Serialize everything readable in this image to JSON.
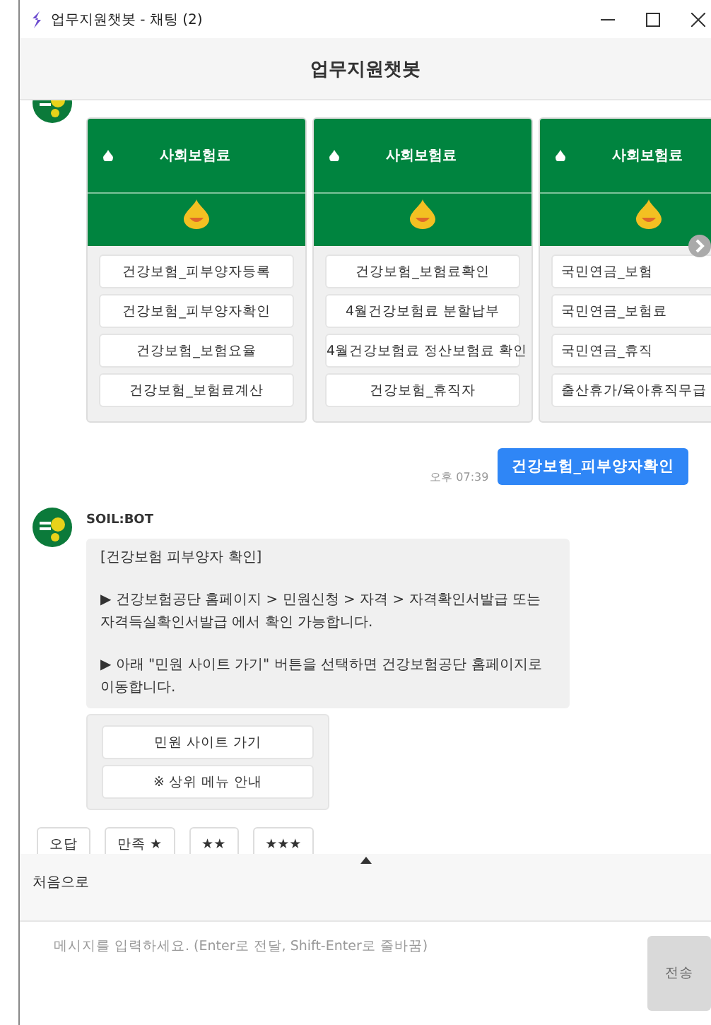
{
  "window": {
    "title": "업무지원챗봇 - 채팅 (2)"
  },
  "header": {
    "title": "업무지원챗봇"
  },
  "carousel": {
    "cards": [
      {
        "title": "사회보험료",
        "buttons": [
          "건강보험_피부양자등록",
          "건강보험_피부양자확인",
          "건강보험_보험요율",
          "건강보험_보험료계산"
        ]
      },
      {
        "title": "사회보험료",
        "buttons": [
          "건강보험_보험료확인",
          "4월건강보험료 분할납부",
          "4월건강보험료 정산보험료 확인",
          "건강보험_휴직자"
        ]
      },
      {
        "title": "사회보험료",
        "buttons": [
          "국민연금_보험",
          "국민연금_보험료",
          "국민연금_휴직",
          "출산휴가/육아휴직무급"
        ]
      }
    ]
  },
  "user_message": {
    "text": "건강보험_피부양자확인",
    "time": "오후 07:39"
  },
  "bot_message": {
    "sender": "SOIL:BOT",
    "paragraphs": [
      "[건강보험 피부양자 확인]",
      "▶ 건강보험공단 홈페이지 > 민원신청 > 자격 > 자격확인서발급 또는 자격득실확인서발급 에서 확인 가능합니다.",
      "▶ 아래 \"민원 사이트 가기\" 버튼을 선택하면 건강보험공단 홈페이지로 이동합니다."
    ],
    "buttons": [
      "민원 사이트 가기",
      "※ 상위 메뉴 안내"
    ]
  },
  "feedback_buttons": [
    "오답",
    "만족 ★",
    "★★",
    "★★★"
  ],
  "quick_menu": {
    "items": [
      "처음으로"
    ]
  },
  "composer": {
    "placeholder": "메시지를 입력하세요. (Enter로 전달, Shift-Enter로 줄바꿈)",
    "send_label": "전송",
    "send_disabled": true
  }
}
